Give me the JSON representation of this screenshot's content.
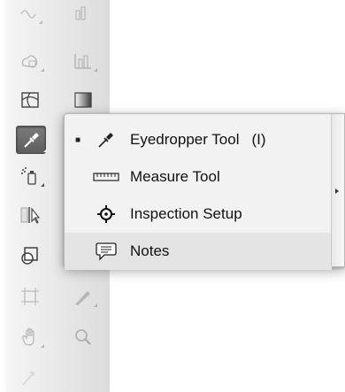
{
  "toolbar": {
    "tools": [
      {
        "name": "symbol-sprayer-tool",
        "icon": "symbol-sprayer-icon"
      },
      {
        "name": "column-graph-tool",
        "icon": "graph-icon"
      },
      {
        "name": "mesh-tool",
        "icon": "mesh-icon"
      },
      {
        "name": "gradient-tool",
        "icon": "gradient-icon"
      },
      {
        "name": "eyedropper-tool",
        "icon": "eyedropper-icon",
        "selected": true
      },
      {
        "name": "symbol-sprayer-tool-2",
        "icon": "spray-can-icon"
      },
      {
        "name": "live-paint-selection-tool",
        "icon": "selection-icon"
      },
      {
        "name": "slice-tool",
        "icon": "slice-icon"
      },
      {
        "name": "artboard-tool",
        "icon": "artboard-icon"
      },
      {
        "name": "knife-tool",
        "icon": "knife-icon"
      },
      {
        "name": "hand-tool",
        "icon": "hand-icon"
      },
      {
        "name": "zoom-tool",
        "icon": "magnifier-icon"
      }
    ]
  },
  "flyout": {
    "items": [
      {
        "label": "Eyedropper Tool",
        "shortcut": "(I)",
        "icon": "eyedropper-icon",
        "checked": true
      },
      {
        "label": "Measure Tool",
        "shortcut": "",
        "icon": "ruler-icon",
        "checked": false
      },
      {
        "label": "Inspection Setup",
        "shortcut": "",
        "icon": "crosshair-icon",
        "checked": false
      },
      {
        "label": "Notes",
        "shortcut": "",
        "icon": "speech-bubble-icon",
        "checked": false,
        "hover": true
      }
    ],
    "check_glyph": "■",
    "tearoff_icon": "chevron-right-icon"
  },
  "colors": {
    "menu_background": "#f2f2f2",
    "hover_row": "#e4e4e4",
    "selected_tool": "#6a6a6a"
  }
}
